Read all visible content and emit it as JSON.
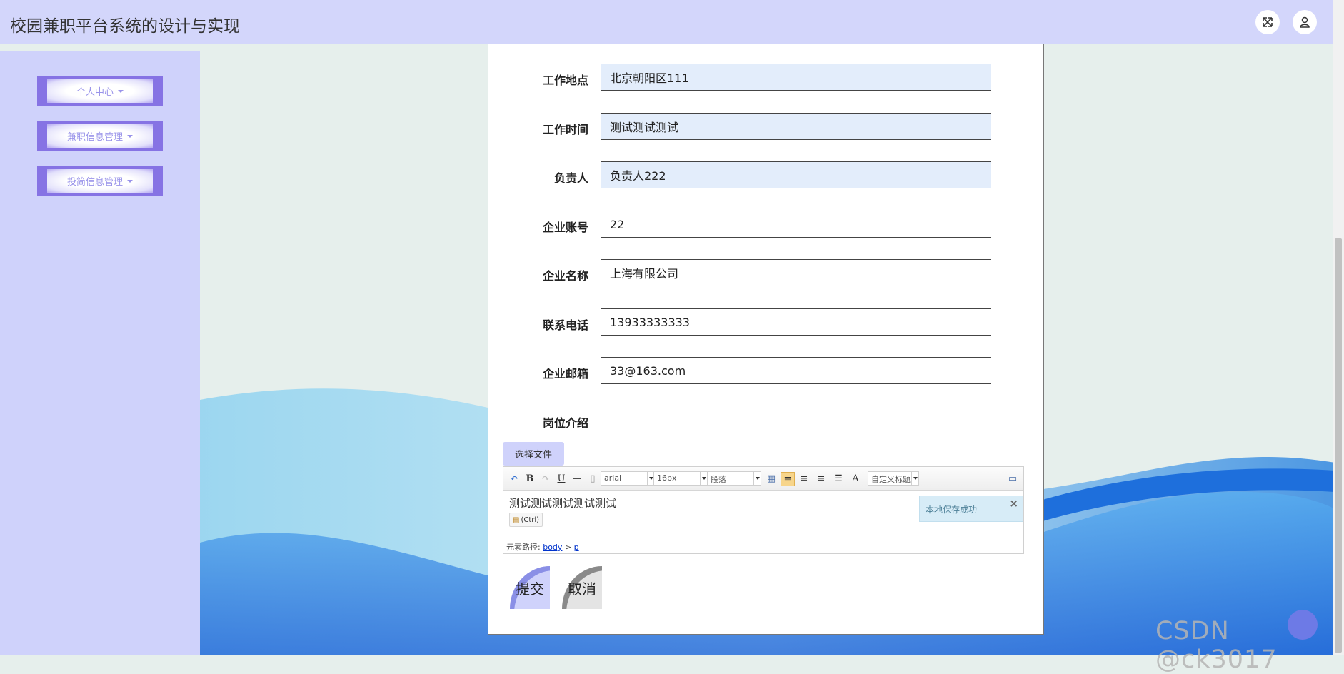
{
  "header": {
    "app_title": "校园兼职平台系统的设计与实现",
    "icons": [
      "fullscreen-icon",
      "user-icon"
    ],
    "bg_color": "#d3d6fb"
  },
  "sidebar": {
    "items": [
      {
        "label": "个人中心"
      },
      {
        "label": "兼职信息管理"
      },
      {
        "label": "投简信息管理"
      }
    ],
    "accent": "#8673e4"
  },
  "form": {
    "fields": [
      {
        "label": "工作地点",
        "value": "北京朝阳区111",
        "readonly": true
      },
      {
        "label": "工作时间",
        "value": "测试测试测试",
        "readonly": true
      },
      {
        "label": "负责人",
        "value": "负责人222",
        "readonly": true
      },
      {
        "label": "企业账号",
        "value": "22",
        "readonly": false
      },
      {
        "label": "企业名称",
        "value": "上海有限公司",
        "readonly": false
      },
      {
        "label": "联系电话",
        "value": "13933333333",
        "readonly": false
      },
      {
        "label": "企业邮箱",
        "value": "33@163.com",
        "readonly": false
      }
    ],
    "intro_label": "岗位介绍",
    "file_button": "选择文件",
    "editor": {
      "font_family": "arial",
      "font_size": "16px",
      "paragraph": "段落",
      "custom_title": "自定义标题",
      "content": "测试测试测试测试测试",
      "paste_chip": "(Ctrl)",
      "toast": "本地保存成功",
      "toast_close": "×",
      "path_label": "元素路径:",
      "path_body": "body",
      "path_sep": ">",
      "path_p": "p"
    },
    "submit_label": "提交",
    "cancel_label": "取消"
  },
  "watermark": "CSDN @ck3017"
}
